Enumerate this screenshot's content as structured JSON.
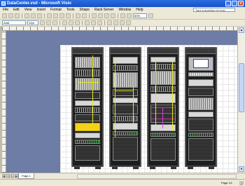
{
  "window": {
    "title": "DataCenter.vsd - Microsoft Visio"
  },
  "menu": [
    "File",
    "Edit",
    "View",
    "Insert",
    "Format",
    "Tools",
    "Shape",
    "Rack Server",
    "Window",
    "Help"
  ],
  "help": {
    "placeholder": "Type a question for help"
  },
  "formatting": {
    "font": "Arial",
    "size": "12pt",
    "zoom": "60%"
  },
  "tabs": {
    "page": "Page-1"
  },
  "status": {
    "page": "Page 1/1"
  }
}
